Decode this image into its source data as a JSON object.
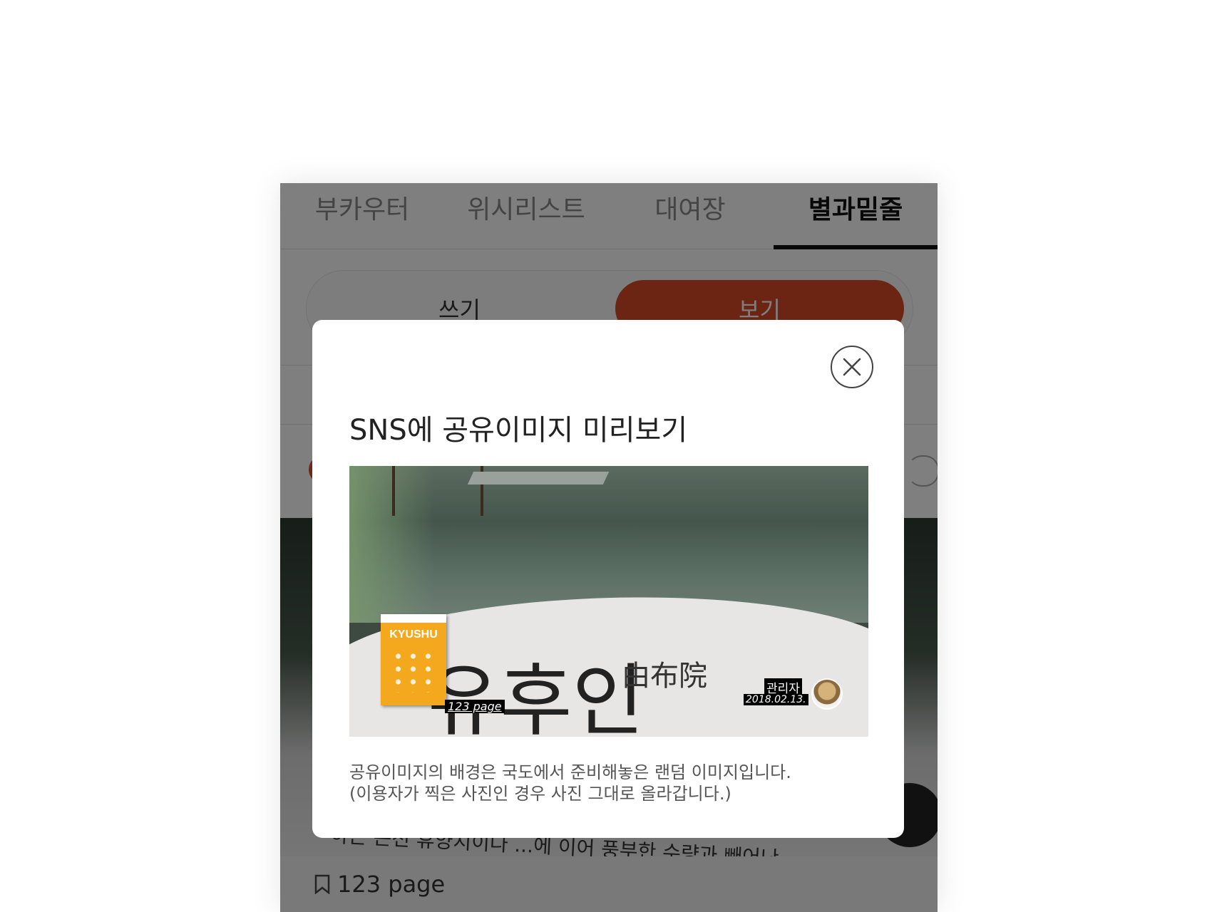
{
  "tabs": [
    {
      "label": "부카우터",
      "active": false
    },
    {
      "label": "위시리스트",
      "active": false
    },
    {
      "label": "대여장",
      "active": false
    },
    {
      "label": "별과밑줄",
      "active": true
    }
  ],
  "toggle": {
    "write_label": "쓰기",
    "view_label": "보기",
    "selected": "보기"
  },
  "background": {
    "text_fragment": "하는 온천 휴양지이다  ...에 이어 풍부한 수량과 빼어난",
    "bookmark_label": "123 page"
  },
  "modal": {
    "title": "SNS에 공유이미지 미리보기",
    "preview": {
      "big_text": "유후인",
      "kanji_text": "由布院",
      "book_title": "KYUSHU",
      "page_label": "123 page",
      "author_name": "관리자",
      "author_date": "2018.02.13."
    },
    "description_line1": "공유이미지의 배경은 국도에서 준비해놓은 랜덤 이미지입니다.",
    "description_line2": "(이용자가 찍은 사진인 경우 사진 그대로 올라갑니다.)"
  },
  "colors": {
    "accent": "#d84a26",
    "book": "#f4a81d"
  },
  "icons": [
    "close-icon",
    "bookmark-icon"
  ]
}
